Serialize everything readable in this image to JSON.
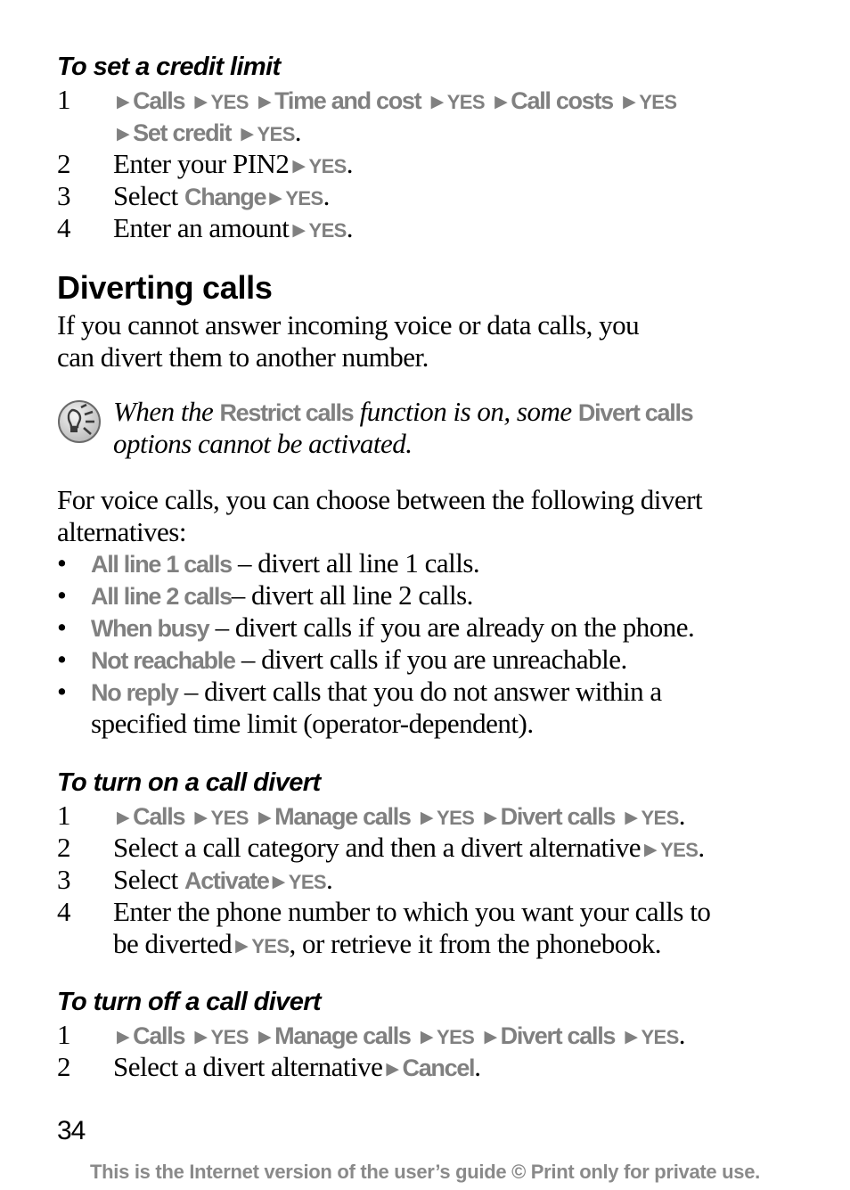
{
  "colors": {
    "menu_gray": "#808080",
    "footer_gray": "#8a8a8a",
    "text": "#000000"
  },
  "credit_limit": {
    "heading": "To set a credit limit",
    "steps": [
      {
        "num": "1",
        "menu1": "Calls",
        "yes1": "YES",
        "menu2": "Time and cost",
        "yes2": "YES",
        "menu3": "Call costs",
        "yes3": "YES",
        "menu4": "Set credit",
        "yes4": "YES",
        "end": "."
      },
      {
        "num": "2",
        "text": "Enter your PIN2",
        "yes": "YES",
        "end": "."
      },
      {
        "num": "3",
        "text": "Select",
        "menu": "Change",
        "yes": "YES",
        "end": "."
      },
      {
        "num": "4",
        "text": "Enter an amount",
        "yes": "YES",
        "end": "."
      }
    ]
  },
  "diverting": {
    "title": "Diverting calls",
    "intro_line1": "If you cannot answer incoming voice or data calls, you",
    "intro_line2": "can divert them to another number.",
    "note": {
      "icon": "lightbulb-tip-icon",
      "part1": "When the",
      "menu1": "Restrict calls",
      "part2": "function is on, some",
      "menu2": "Divert calls",
      "line2": "options cannot be activated."
    },
    "voice_line1": "For voice calls, you can choose between the following divert",
    "voice_line2": "alternatives:",
    "bullet_char": "•",
    "alternatives": [
      {
        "name": "All line 1 calls",
        "desc": " – divert all line 1 calls."
      },
      {
        "name": "All line 2 calls",
        "desc": "– divert all line 2 calls."
      },
      {
        "name": "When busy",
        "desc": " – divert calls if you are already on the phone."
      },
      {
        "name": "Not reachable",
        "desc": " – divert calls if you are unreachable."
      },
      {
        "name": "No reply",
        "desc": " – divert calls that you do not answer within a",
        "desc2": "specified time limit (operator-dependent)."
      }
    ]
  },
  "turn_on": {
    "heading": "To turn on a call divert",
    "steps": [
      {
        "num": "1",
        "menu1": "Calls",
        "yes1": "YES",
        "menu2": "Manage calls",
        "yes2": "YES",
        "menu3": "Divert calls",
        "yes3": "YES",
        "end": "."
      },
      {
        "num": "2",
        "text": "Select a call category and then a divert alternative",
        "yes": "YES",
        "end": "."
      },
      {
        "num": "3",
        "text": "Select",
        "menu": "Activate",
        "yes": "YES",
        "end": "."
      },
      {
        "num": "4",
        "text": "Enter the phone number to which you want your calls to",
        "text2": "be diverted",
        "yes": "YES",
        "end": ", or retrieve it from the phonebook."
      }
    ]
  },
  "turn_off": {
    "heading": "To turn off a call divert",
    "steps": [
      {
        "num": "1",
        "menu1": "Calls",
        "yes1": "YES",
        "menu2": "Manage calls",
        "yes2": "YES",
        "menu3": "Divert calls",
        "yes3": "YES",
        "end": "."
      },
      {
        "num": "2",
        "text": "Select a divert alternative",
        "menu": "Cancel",
        "end": "."
      }
    ]
  },
  "arrow_glyph": "▶",
  "page_number": "34",
  "footer": "This is the Internet version of the user’s guide © Print only for private use."
}
